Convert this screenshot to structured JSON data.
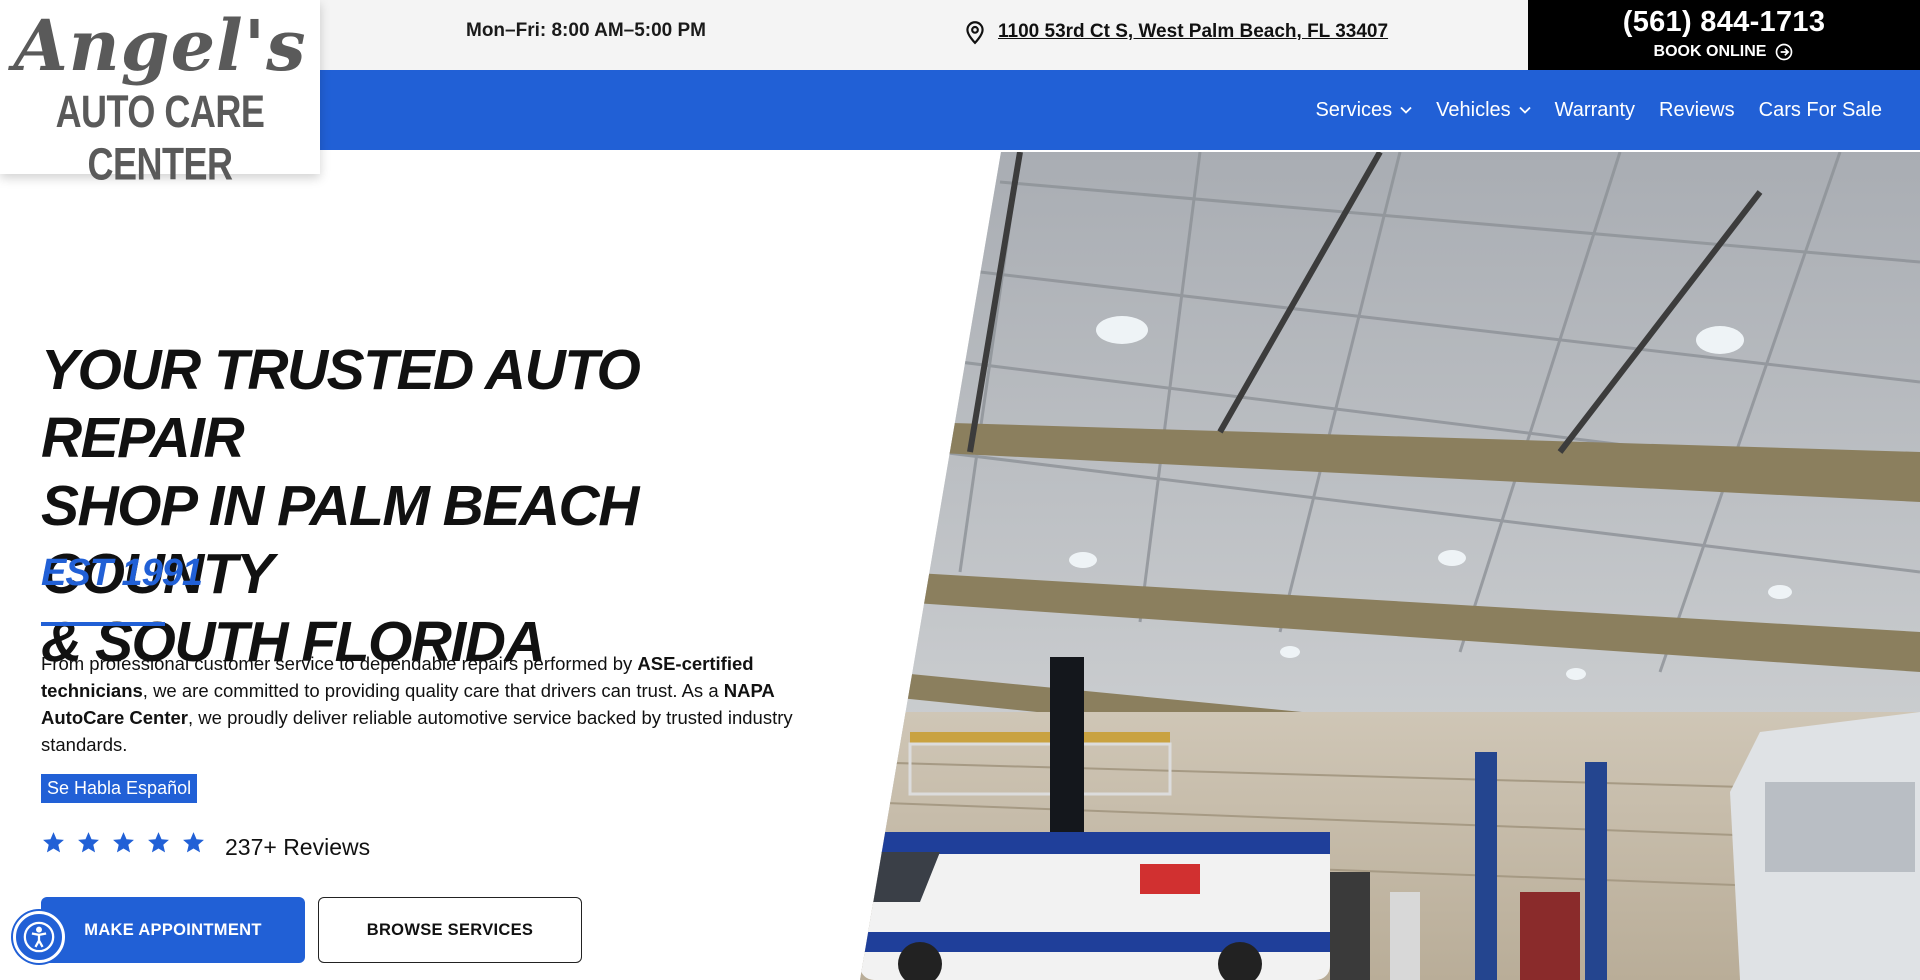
{
  "topbar": {
    "hours": "Mon–Fri: 8:00 AM–5:00 PM",
    "address": "1100 53rd Ct S, West Palm Beach, FL 33407",
    "phone": "(561) 844-1713",
    "book_online": "BOOK ONLINE"
  },
  "logo": {
    "script": "Angel's",
    "subtitle": "AUTO CARE CENTER"
  },
  "nav": {
    "items": [
      {
        "label": "Services",
        "has_dropdown": true
      },
      {
        "label": "Vehicles",
        "has_dropdown": true
      },
      {
        "label": "Warranty",
        "has_dropdown": false
      },
      {
        "label": "Reviews",
        "has_dropdown": false
      },
      {
        "label": "Cars For Sale",
        "has_dropdown": false
      }
    ]
  },
  "hero": {
    "headline_lines": [
      "YOUR TRUSTED AUTO REPAIR",
      "SHOP IN PALM BEACH COUNTY",
      "& SOUTH FLORIDA"
    ],
    "est": "EST 1991",
    "paragraph": {
      "p1": "From professional customer service to dependable repairs performed by ",
      "b1": "ASE-certified technicians",
      "p2": ", we are committed to providing quality care that drivers can trust. As a ",
      "b2": "NAPA AutoCare Center",
      "p3": ", we proudly deliver reliable automotive service backed by trusted industry standards."
    },
    "badge": "Se Habla Español",
    "rating_stars": 5,
    "reviews": "237+ Reviews",
    "primary_button": "MAKE APPOINTMENT",
    "secondary_button": "BROWSE SERVICES",
    "image_alt": "Interior of auto repair garage with vehicles on lifts"
  },
  "colors": {
    "brand_blue": "#2160d6",
    "topbar_bg": "#f4f4f4",
    "phone_bg": "#000000",
    "logo_gray": "#5a5a5a"
  },
  "icons": {
    "address": "map-pin-icon",
    "book": "arrow-circle-right-icon",
    "dropdown": "chevron-down-icon",
    "rating": "star-icon",
    "accessibility": "accessibility-icon"
  }
}
